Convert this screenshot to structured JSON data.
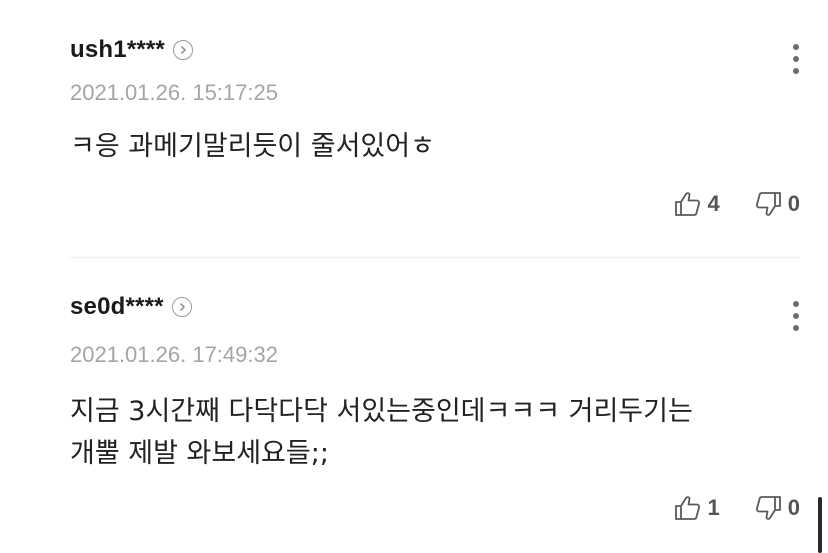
{
  "comments": [
    {
      "username": "ush1****",
      "date": "2021.01.26. 15:17:25",
      "text": "ㅋ응 과메기말리듯이 줄서있어ㅎ",
      "likes": "4",
      "dislikes": "0"
    },
    {
      "username": "se0d****",
      "date": "2021.01.26. 17:49:32",
      "text_line1": "지금 3시간째 다닥다닥 서있는중인데ㅋㅋㅋ 거리두기는",
      "text_line2": "개뿔 제발 와보세요들;;",
      "likes": "1",
      "dislikes": "0"
    }
  ],
  "icons": {
    "profile": "chevron-right-circle-icon",
    "more": "more-vertical-icon",
    "like": "thumbs-up-icon",
    "dislike": "thumbs-down-icon"
  },
  "colors": {
    "username": "#1a1a1a",
    "date": "#a5a5a5",
    "text": "#222222",
    "count": "#555555"
  }
}
